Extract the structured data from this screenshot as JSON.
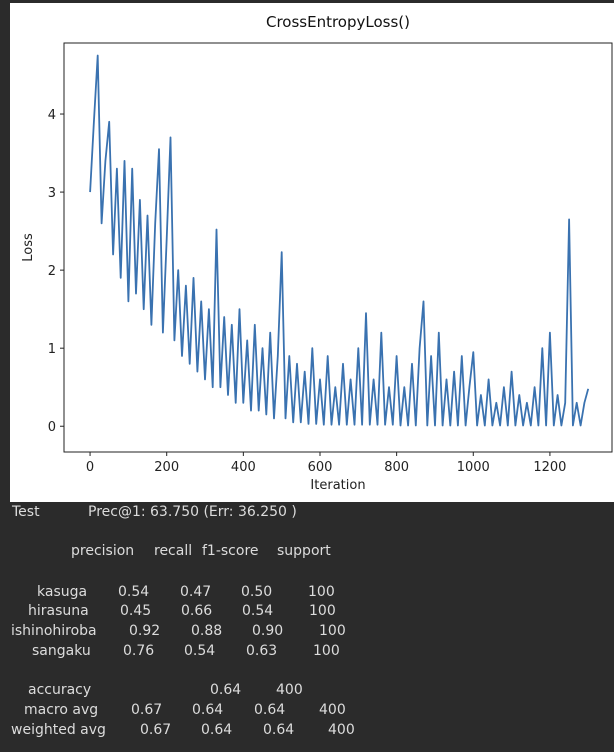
{
  "chart_data": {
    "type": "line",
    "title": "CrossEntropyLoss()",
    "xlabel": "Iteration",
    "ylabel": "Loss",
    "xlim": [
      -68,
      1362
    ],
    "ylim": [
      -0.33,
      4.91
    ],
    "xticks": [
      0,
      200,
      400,
      600,
      800,
      1000,
      1200
    ],
    "yticks": [
      0,
      1,
      2,
      3,
      4
    ],
    "grid": false,
    "line_color": "#3a72b0",
    "x_start": 0,
    "x_step": 10,
    "values": [
      3.0,
      3.9,
      4.75,
      2.6,
      3.4,
      3.9,
      2.2,
      3.3,
      1.9,
      3.4,
      1.6,
      3.3,
      1.7,
      2.9,
      1.5,
      2.7,
      1.3,
      2.6,
      3.55,
      1.2,
      2.4,
      3.7,
      1.1,
      2.0,
      0.9,
      1.8,
      0.8,
      1.9,
      0.7,
      1.6,
      0.6,
      1.5,
      0.5,
      2.52,
      0.5,
      1.4,
      0.4,
      1.3,
      0.3,
      1.5,
      0.3,
      1.1,
      0.2,
      1.3,
      0.2,
      1.0,
      0.15,
      1.2,
      0.1,
      0.9,
      2.23,
      0.1,
      0.9,
      0.05,
      0.8,
      0.05,
      0.7,
      0.03,
      1.0,
      0.03,
      0.6,
      0.02,
      0.9,
      0.02,
      0.5,
      0.02,
      0.8,
      0.02,
      0.6,
      0.02,
      1.0,
      0.02,
      1.45,
      0.02,
      0.6,
      0.02,
      1.2,
      0.02,
      0.5,
      0.02,
      0.9,
      0.01,
      0.5,
      0.01,
      0.8,
      0.01,
      1.0,
      1.6,
      0.01,
      0.9,
      0.01,
      1.2,
      0.01,
      0.6,
      0.01,
      0.7,
      0.01,
      0.9,
      0.01,
      0.5,
      0.95,
      0.01,
      0.4,
      0.01,
      0.6,
      0.01,
      0.3,
      0.01,
      0.5,
      0.01,
      0.7,
      0.01,
      0.4,
      0.01,
      0.3,
      0.01,
      0.5,
      0.01,
      1.0,
      0.01,
      1.2,
      0.01,
      0.4,
      0.01,
      0.3,
      2.65,
      0.01,
      0.3,
      0.01,
      0.3,
      0.48
    ]
  },
  "console": {
    "test_label": "Test",
    "test_result": "Prec@1: 63.750 (Err: 36.250 )",
    "report": {
      "header": [
        "precision",
        "recall",
        "f1-score",
        "support"
      ],
      "rows": [
        [
          "kasuga",
          "0.54",
          "0.47",
          "0.50",
          "100"
        ],
        [
          "hirasuna",
          "0.45",
          "0.66",
          "0.54",
          "100"
        ],
        [
          "ishinohiroba",
          "0.92",
          "0.88",
          "0.90",
          "100"
        ],
        [
          "sangaku",
          "0.76",
          "0.54",
          "0.63",
          "100"
        ],
        [
          "accuracy",
          "",
          "",
          "0.64",
          "400"
        ],
        [
          "macro avg",
          "0.67",
          "0.64",
          "0.64",
          "400"
        ],
        [
          "weighted avg",
          "0.67",
          "0.64",
          "0.64",
          "400"
        ]
      ]
    }
  }
}
